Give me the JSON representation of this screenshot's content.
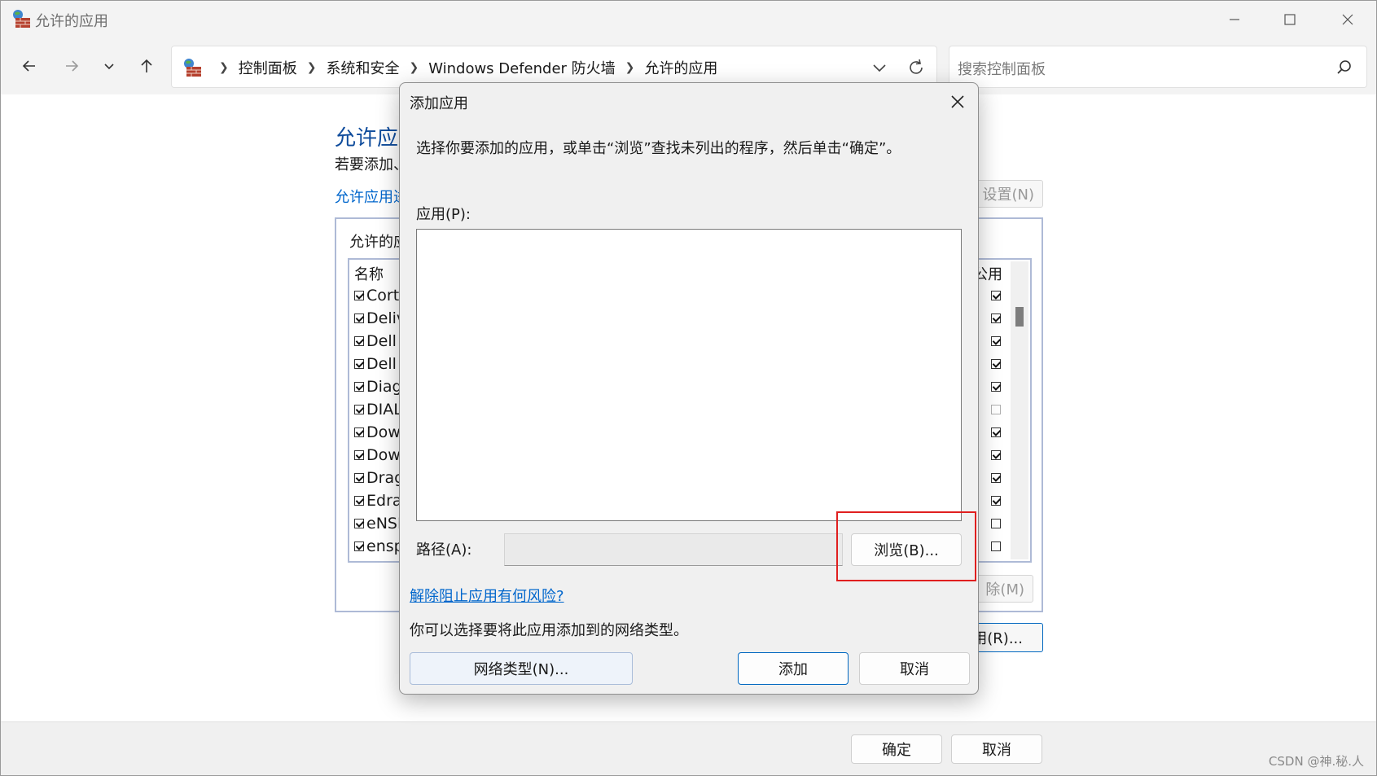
{
  "window": {
    "title": "允许的应用",
    "controls": [
      "minimize-icon",
      "maximize-icon",
      "close-icon"
    ]
  },
  "nav": {
    "back": "back-arrow-icon",
    "forward": "forward-arrow-icon",
    "recent": "chevron-down-icon",
    "up": "up-arrow-icon"
  },
  "address": {
    "breadcrumb": [
      "控制面板",
      "系统和安全",
      "Windows Defender 防火墙",
      "允许的应用"
    ]
  },
  "search": {
    "placeholder": "搜索控制面板"
  },
  "background": {
    "heading": "允许应",
    "description": "若要添加、",
    "link": "允许应用进",
    "change_settings": "设置(N)",
    "group_title": "允许的应",
    "list_header_name": "名称",
    "list_header_public": "公用",
    "rows": [
      {
        "name": "Corta",
        "private": true,
        "public": true
      },
      {
        "name": "Deliv",
        "private": true,
        "public": true
      },
      {
        "name": "Dell I",
        "private": true,
        "public": true
      },
      {
        "name": "Dell S",
        "private": true,
        "public": true
      },
      {
        "name": "Diag",
        "private": true,
        "public": true
      },
      {
        "name": "DIAL",
        "private": true,
        "public": false
      },
      {
        "name": "Dowr",
        "private": true,
        "public": true
      },
      {
        "name": "Dowr",
        "private": true,
        "public": true
      },
      {
        "name": "Drag",
        "private": true,
        "public": true
      },
      {
        "name": "Edrav",
        "private": true,
        "public": true
      },
      {
        "name": "eNSP",
        "private": true,
        "public": false
      },
      {
        "name": "ensp",
        "private": true,
        "public": false
      }
    ],
    "remove": "除(M)",
    "allow_other": "用(R)..."
  },
  "footer": {
    "ok": "确定",
    "cancel": "取消"
  },
  "dialog": {
    "title": "添加应用",
    "instruction": "选择你要添加的应用，或单击“浏览”查找未列出的程序，然后单击“确定”。",
    "apps_label": "应用(P):",
    "path_label": "路径(A):",
    "path_value": "",
    "browse": "浏览(B)...",
    "risk_link": "解除阻止应用有何风险?",
    "network_text": "你可以选择要将此应用添加到的网络类型。",
    "network_types": "网络类型(N)...",
    "add": "添加",
    "cancel": "取消"
  },
  "watermark": "CSDN @神.秘.人",
  "colors": {
    "accent": "#0067c0",
    "link": "#0066cc",
    "heading": "#0f4c9c",
    "highlight": "#e01f1f"
  }
}
